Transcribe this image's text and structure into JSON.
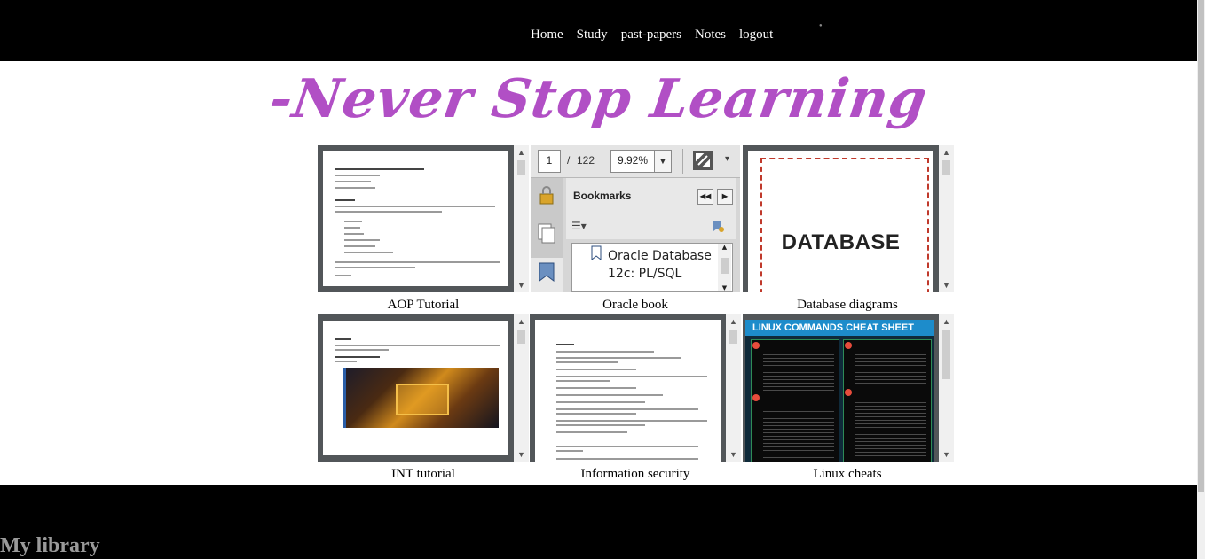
{
  "nav": {
    "items": [
      "Home",
      "Study",
      "past-papers",
      "Notes",
      "logout"
    ]
  },
  "slogan": "-Never Stop Learning",
  "tiles": [
    {
      "caption": "AOP Tutorial"
    },
    {
      "caption": "Oracle book"
    },
    {
      "caption": "Database diagrams"
    },
    {
      "caption": "INT tutorial"
    },
    {
      "caption": "Information security"
    },
    {
      "caption": "Linux cheats"
    }
  ],
  "oracle_viewer": {
    "page_current": "1",
    "page_separator": "/",
    "page_total": "122",
    "zoom": "9.92%",
    "bookmarks_label": "Bookmarks",
    "bookmark_item": "Oracle Database 12c: PL/SQL"
  },
  "database_cover": {
    "title": "DATABASE"
  },
  "linux_cover": {
    "title": "LINUX COMMANDS CHEAT SHEET"
  },
  "footer": {
    "title": "My library"
  },
  "colors": {
    "accent": "#b14fc5",
    "pdf_frame": "#525659",
    "linux_header": "#1d8ccb"
  }
}
